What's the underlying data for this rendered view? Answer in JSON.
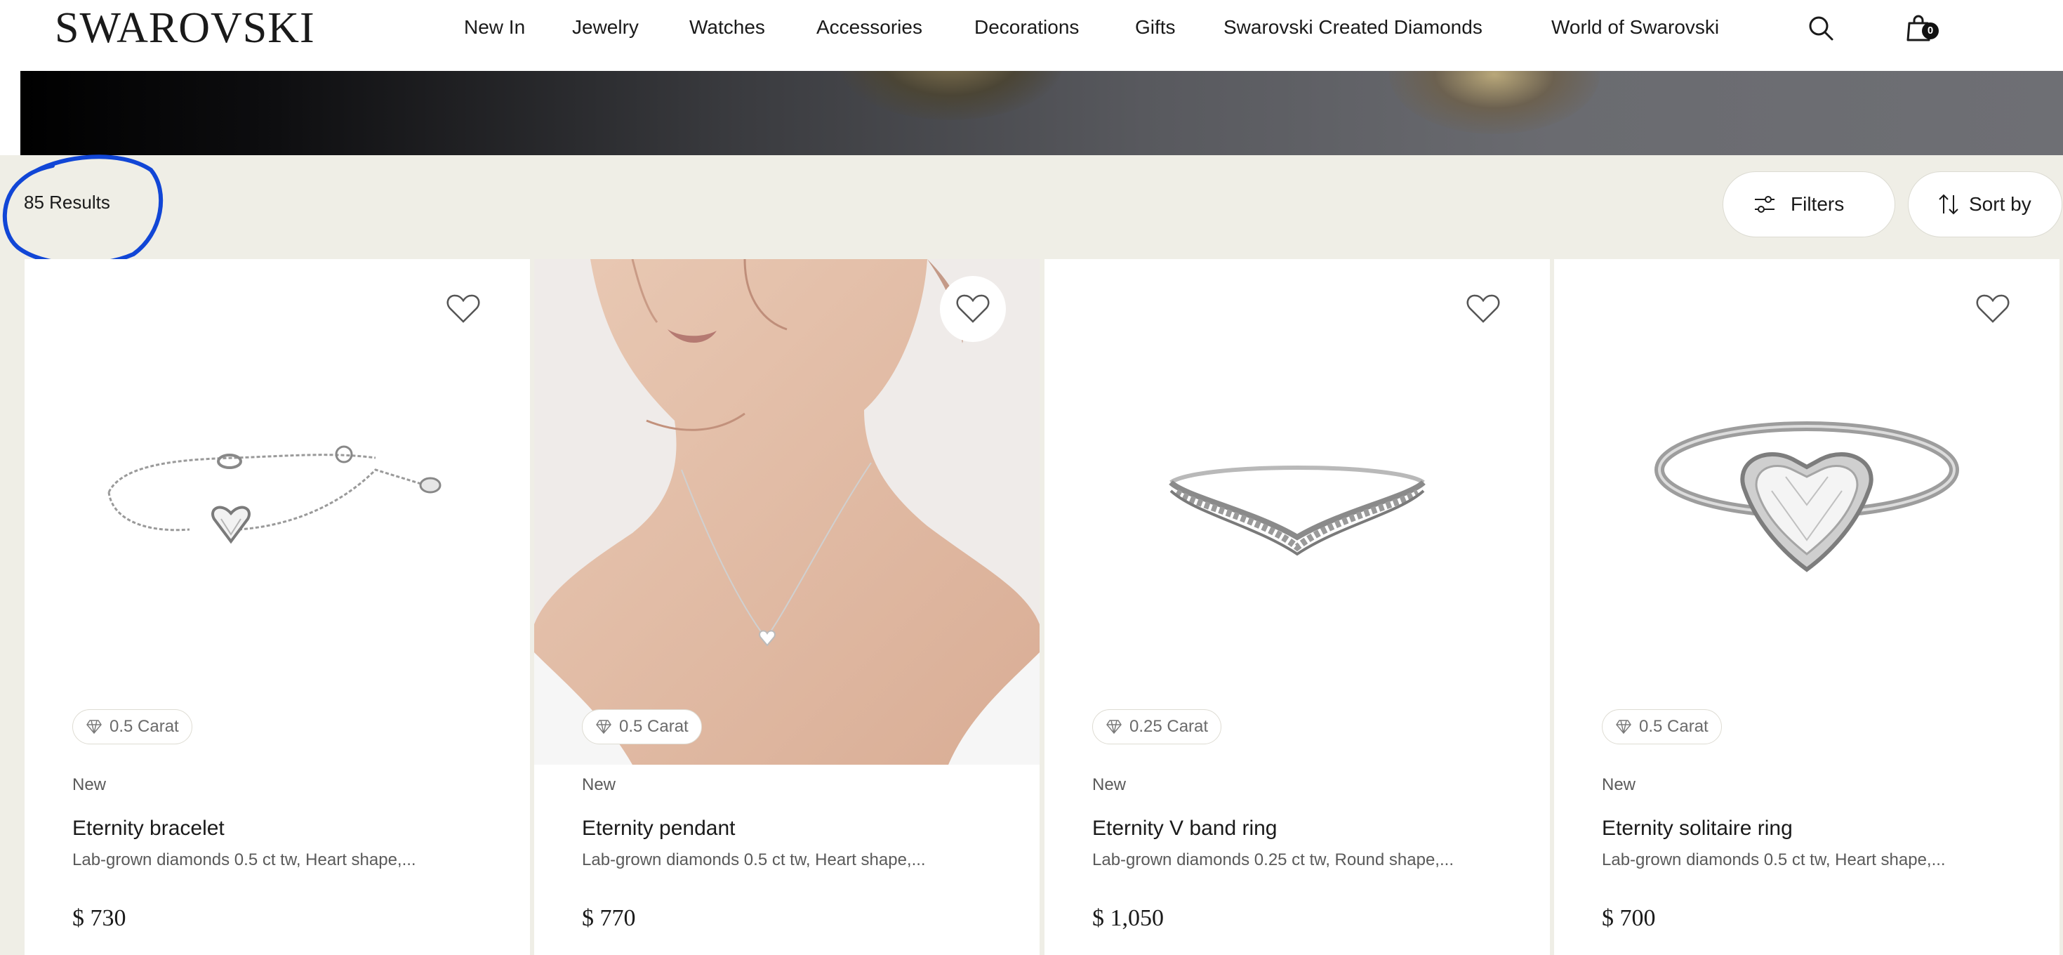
{
  "header": {
    "logo": "SWAROVSKI",
    "nav": [
      "New In",
      "Jewelry",
      "Watches",
      "Accessories",
      "Decorations",
      "Gifts",
      "Swarovski Created Diamonds",
      "World of Swarovski"
    ],
    "search_icon": "search-icon",
    "cart_icon": "shopping-bag-icon",
    "cart_count": "0"
  },
  "results": {
    "count_label": "85 Results",
    "filters_label": "Filters",
    "sort_label": "Sort by"
  },
  "products": [
    {
      "carat": "0.5 Carat",
      "badge": "New",
      "title": "Eternity bracelet",
      "description": "Lab-grown diamonds 0.5 ct tw, Heart shape,...",
      "price": "$ 730",
      "image": "heart-bracelet"
    },
    {
      "carat": "0.5 Carat",
      "badge": "New",
      "title": "Eternity pendant",
      "description": "Lab-grown diamonds 0.5 ct tw, Heart shape,...",
      "price": "$ 770",
      "image": "model-wearing-pendant"
    },
    {
      "carat": "0.25 Carat",
      "badge": "New",
      "title": "Eternity V band ring",
      "description": "Lab-grown diamonds 0.25 ct tw, Round shape,...",
      "price": "$ 1,050",
      "image": "v-band-ring"
    },
    {
      "carat": "0.5 Carat",
      "badge": "New",
      "title": "Eternity solitaire ring",
      "description": "Lab-grown diamonds 0.5 ct tw, Heart shape,...",
      "price": "$ 700",
      "image": "heart-solitaire-ring"
    }
  ],
  "colors": {
    "results_bar": "#efeee6",
    "annotation": "#1146d6"
  }
}
